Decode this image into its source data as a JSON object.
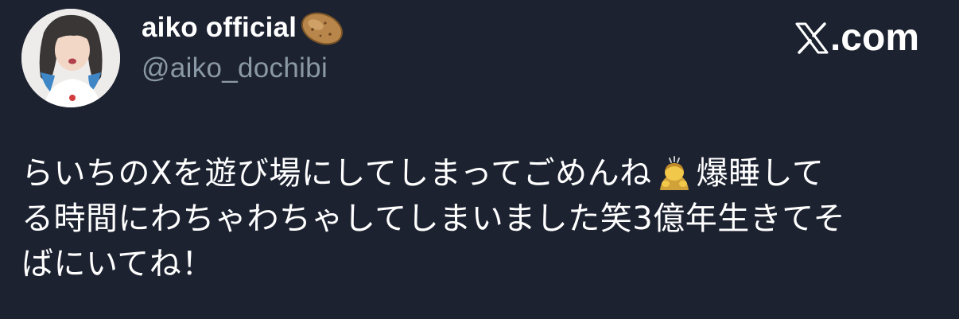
{
  "tweet": {
    "author_name": "aiko official",
    "author_handle": "@aiko_dochibi",
    "name_emoji_icon": "potato-icon",
    "brand": ".com",
    "brand_icon": "x-logo-icon",
    "text_line1_a": "らいちのXを遊び場にしてしまってごめんね",
    "text_emoji_icon": "person-bowing-icon",
    "text_line1_b": "爆睡して",
    "text_line2": "る時間にわちゃわちゃしてしまいました笑3億年生きてそ",
    "text_line3": "ばにいてね！"
  },
  "colors": {
    "background": "#1c2230",
    "text": "#ffffff",
    "handle": "#8b98a5"
  }
}
